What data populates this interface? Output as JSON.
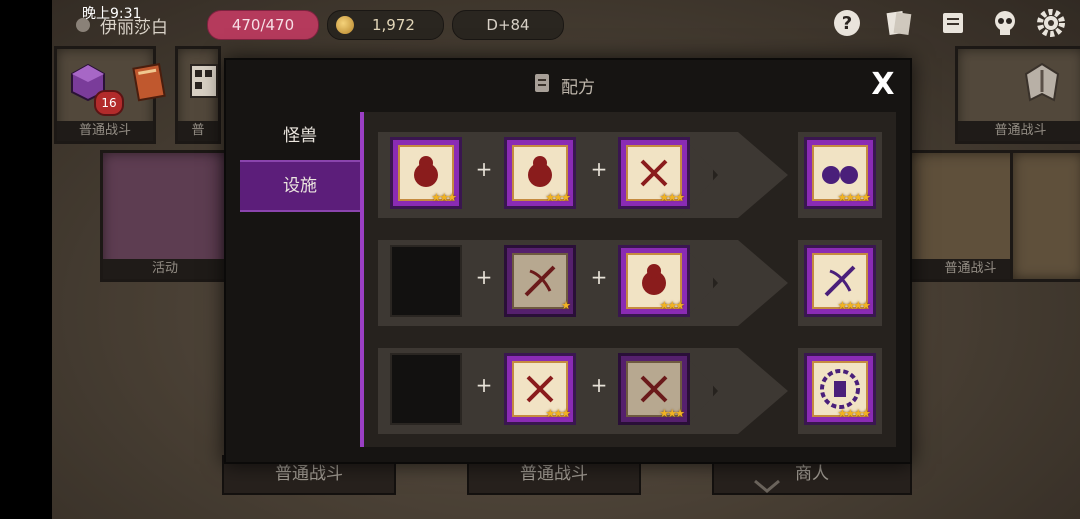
{
  "status_bar": {
    "time": "晚上9:31"
  },
  "header": {
    "player_name": "伊丽莎白",
    "hp": "470/470",
    "gold": "1,972",
    "day": "D+84",
    "inventory_badge": "16"
  },
  "background": {
    "cards": [
      {
        "label": "普通战斗"
      },
      {
        "label": "普"
      },
      {
        "label": "活动"
      },
      {
        "label": "普通战斗"
      },
      {
        "label": "普通战斗"
      }
    ],
    "bottom_buttons": [
      "普通战斗",
      "普通战斗",
      "商人"
    ]
  },
  "modal": {
    "title": "配方",
    "close_label": "X",
    "tabs": [
      {
        "label": "怪兽",
        "active": false
      },
      {
        "label": "设施",
        "active": true
      }
    ],
    "recipes": [
      {
        "ingredients": [
          {
            "icon": "monster-icon",
            "stars": "★★★",
            "frame": "purple"
          },
          {
            "icon": "monster-icon",
            "stars": "★★★",
            "frame": "purple"
          },
          {
            "icon": "dna-icon",
            "stars": "★★★",
            "frame": "purple"
          }
        ],
        "result": {
          "icon": "twin-monster-icon",
          "stars": "★★★★",
          "frame": "purple"
        }
      },
      {
        "ingredients": [
          {
            "icon": "empty",
            "stars": "",
            "frame": "empty"
          },
          {
            "icon": "crossbow-icon",
            "stars": "★",
            "frame": "dim-purple"
          },
          {
            "icon": "monster-icon",
            "stars": "★★★",
            "frame": "purple"
          }
        ],
        "result": {
          "icon": "crossbow-icon",
          "stars": "★★★★",
          "frame": "purple"
        }
      },
      {
        "ingredients": [
          {
            "icon": "empty",
            "stars": "",
            "frame": "empty"
          },
          {
            "icon": "dna-icon",
            "stars": "★★★",
            "frame": "purple"
          },
          {
            "icon": "dna-icon",
            "stars": "★★★",
            "frame": "dim-purple"
          }
        ],
        "result": {
          "icon": "lab-gear-icon",
          "stars": "★★★★",
          "frame": "purple"
        }
      }
    ],
    "plus_symbol": "+"
  },
  "colors": {
    "accent_purple": "#8a2bb4",
    "tab_active": "#5c1e7a",
    "hp_pill": "#b53a5c",
    "star": "#f2b422"
  }
}
